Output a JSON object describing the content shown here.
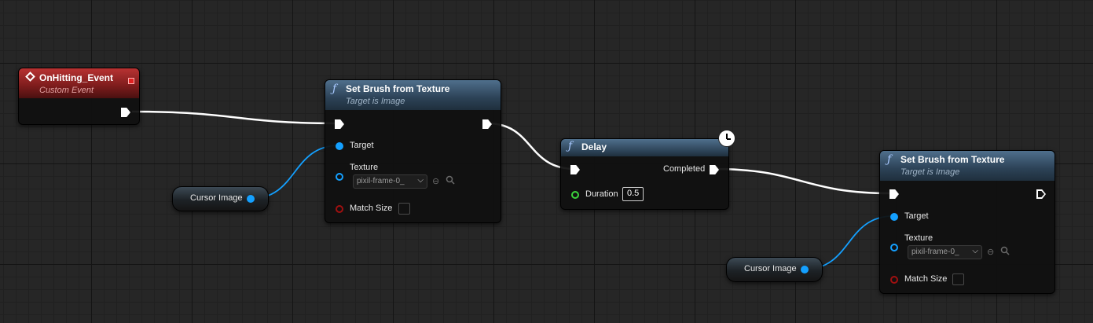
{
  "nodes": {
    "event": {
      "title": "OnHitting_Event",
      "subtitle": "Custom Event"
    },
    "set_brush_1": {
      "title": "Set Brush from Texture",
      "subtitle": "Target is Image",
      "target_label": "Target",
      "texture_label": "Texture",
      "texture_value": "pixil-frame-0_",
      "match_size_label": "Match Size"
    },
    "delay": {
      "title": "Delay",
      "completed_label": "Completed",
      "duration_label": "Duration",
      "duration_value": "0.5"
    },
    "set_brush_2": {
      "title": "Set Brush from Texture",
      "subtitle": "Target is Image",
      "target_label": "Target",
      "texture_label": "Texture",
      "texture_value": "pixil-frame-0_",
      "match_size_label": "Match Size"
    },
    "var_1": {
      "label": "Cursor Image"
    },
    "var_2": {
      "label": "Cursor Image"
    }
  },
  "icons": {
    "function": "ƒ",
    "event": "diamond-event-icon",
    "dropdown": "⌵",
    "use_asset": "⊖",
    "browse": "🔍"
  },
  "colors": {
    "exec": "#ffffff",
    "object_pin": "#14a0ff",
    "float_pin": "#3cd43c",
    "bool_pin": "#a01010",
    "event_header": "#b83232",
    "function_header": "#4f6f8c"
  }
}
